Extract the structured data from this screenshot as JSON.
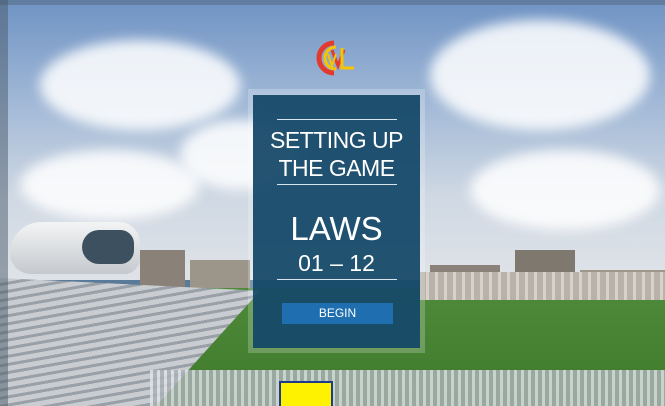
{
  "panel": {
    "title_line1": "SETTING UP",
    "title_line2": "THE GAME",
    "laws_label": "LAWS",
    "laws_range": "01 – 12",
    "begin_label": "BEGIN"
  },
  "colors": {
    "panel": "#124666",
    "button": "#1f6fb0",
    "logo_red": "#e23b2e",
    "logo_yellow": "#f6c500",
    "highlight": "#fff200"
  },
  "icons": {
    "logo": "mcc-logo-icon"
  }
}
